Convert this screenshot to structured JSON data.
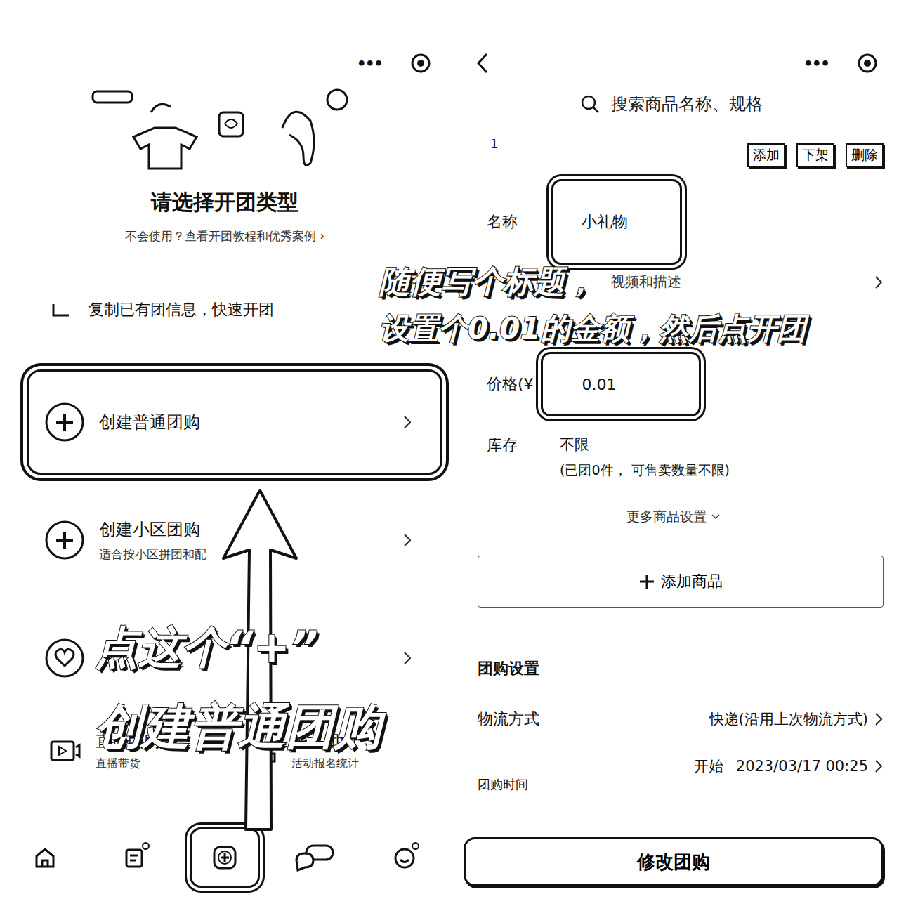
{
  "left_screen": {
    "more": "•••",
    "title": "请选择开团类型",
    "subtitle": "不会使用？查看开团教程和优秀案例 ›",
    "copy_row": "复制已有团信息，快速开团",
    "options": [
      {
        "kind": "plus",
        "title": "创建普通团购",
        "highlighted": true
      },
      {
        "kind": "plus",
        "title": "创建小区团购",
        "subtitle": "适合按小区拼团和配",
        "highlighted": false
      },
      {
        "kind": "heart",
        "highlighted": false
      }
    ],
    "extras": [
      {
        "kind": "video",
        "title": "直播团购",
        "subtitle": "直播带货"
      },
      {
        "kind": "form",
        "title": "报名团购",
        "subtitle": "活动报名统计"
      }
    ],
    "tabbar": [
      {
        "kind": "home",
        "badge": false,
        "highlighted": false
      },
      {
        "kind": "list",
        "badge": true,
        "highlighted": false
      },
      {
        "kind": "create",
        "badge": false,
        "highlighted": true
      },
      {
        "kind": "chat",
        "badge": false,
        "highlighted": false
      },
      {
        "kind": "profile",
        "badge": true,
        "highlighted": false
      }
    ],
    "annotation": [
      "点这个“+”",
      "创建普通团购"
    ]
  },
  "right_screen": {
    "more": "•••",
    "search_placeholder": "搜索商品名称、规格",
    "item_index": "1",
    "item_actions": [
      "添加",
      "下架",
      "删除"
    ],
    "name_label": "名称",
    "name_value": "小礼物",
    "media_text": "视频和描述",
    "price_label": "价格(¥",
    "price_value": "0.01",
    "stock_label": "库存",
    "stock_value": "不限",
    "stock_note": "(已团0件， 可售卖数量不限)",
    "more_settings": "更多商品设置",
    "add_product": "添加商品",
    "section_title": "团购设置",
    "logistics_label": "物流方式",
    "logistics_value": "快递(沿用上次物流方式)",
    "start_prefix": "开始",
    "start_value": "2023/03/17 00:25",
    "time_label": "团购时间",
    "submit": "修改团购",
    "annotation": [
      "随便写个标题，",
      "设置个0.01的金额，然后点开团"
    ]
  }
}
